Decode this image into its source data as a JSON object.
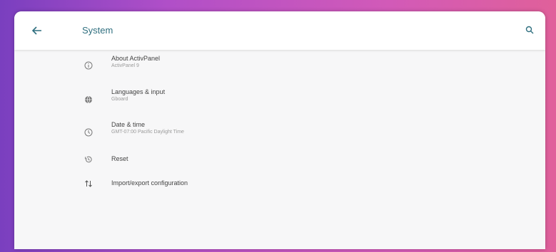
{
  "colors": {
    "accent": "#2f6f7f",
    "icon": "#7a7a7a",
    "background": "#f7f7f8"
  },
  "header": {
    "title": "System",
    "back_icon": "arrow-left-icon",
    "search_icon": "search-icon"
  },
  "items": [
    {
      "label": "About ActivPanel",
      "summary": "ActivPanel 9",
      "icon": "info-icon"
    },
    {
      "label": "Languages & input",
      "summary": "Gboard",
      "icon": "globe-icon"
    },
    {
      "label": "Date & time",
      "summary": "GMT-07:00 Pacific Daylight Time",
      "icon": "clock-icon"
    },
    {
      "label": "Reset",
      "summary": "",
      "icon": "history-icon"
    },
    {
      "label": "Import/export configuration",
      "summary": "",
      "icon": "import-export-icon"
    }
  ]
}
